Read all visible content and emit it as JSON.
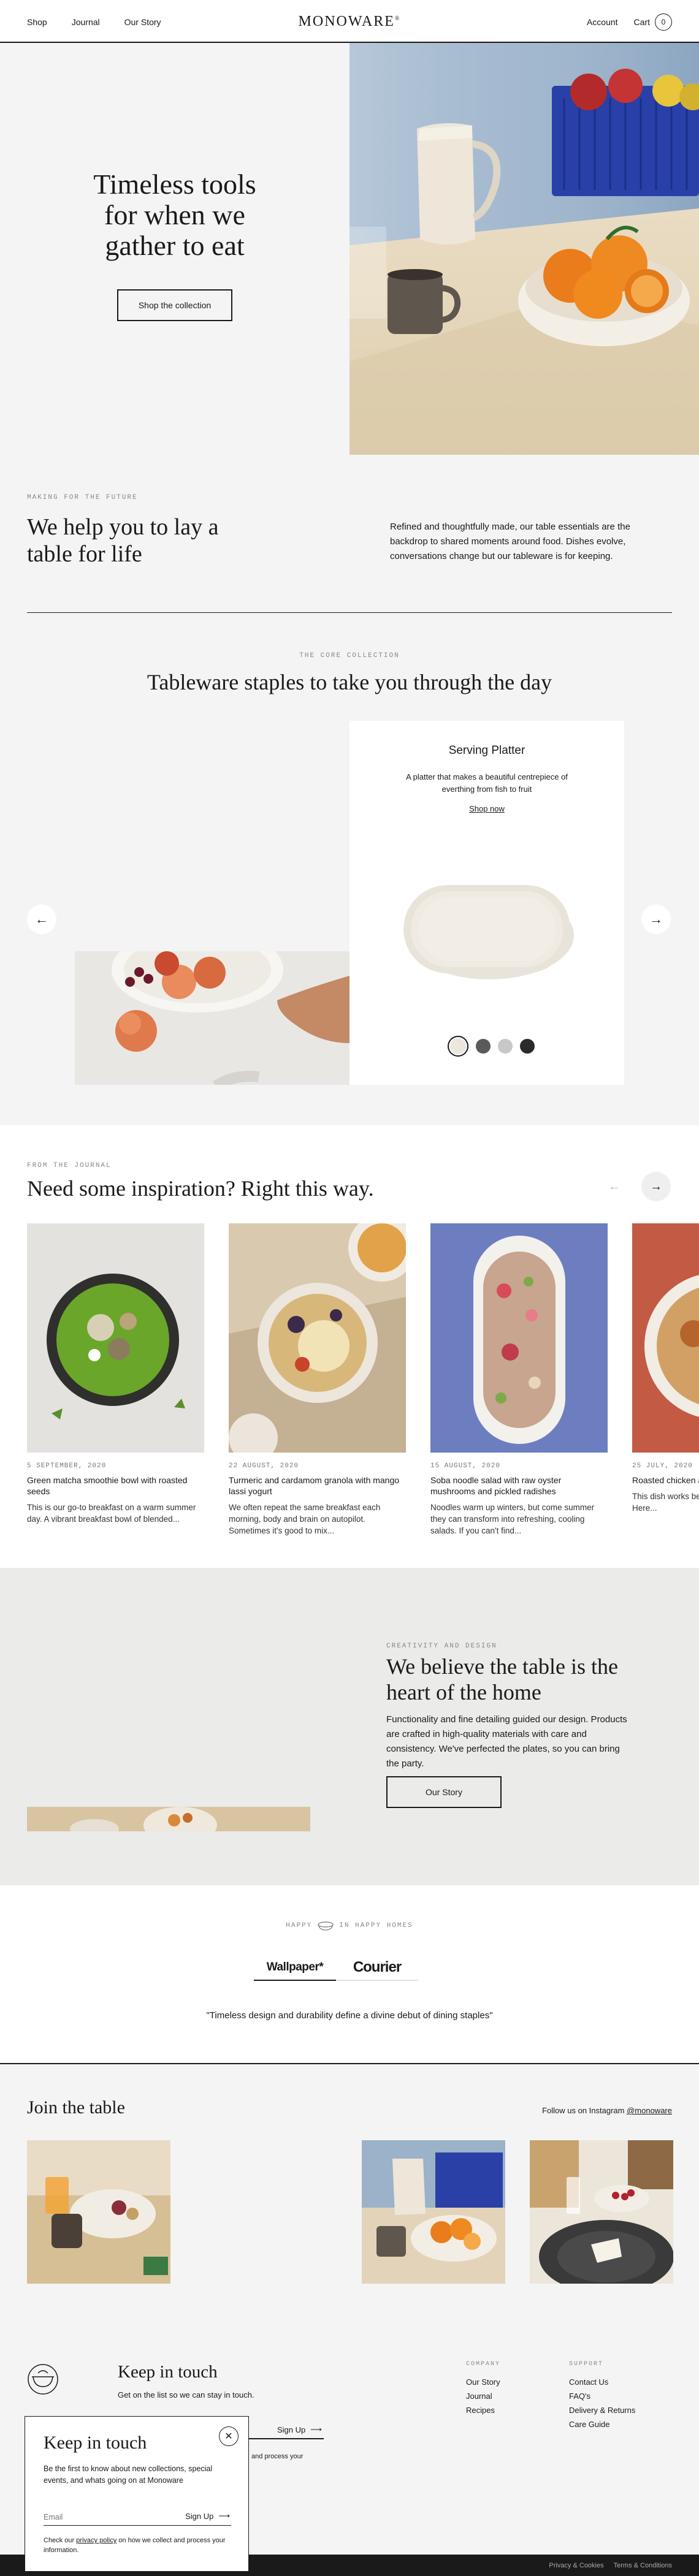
{
  "header": {
    "nav": [
      "Shop",
      "Journal",
      "Our Story"
    ],
    "logo": "MONOWARE",
    "logo_mark": "®",
    "account": "Account",
    "cart_label": "Cart",
    "cart_count": "0"
  },
  "hero": {
    "title_lines": [
      "Timeless tools",
      "for when we",
      "gather to eat"
    ],
    "button": "Shop the collection"
  },
  "intro": {
    "eyebrow": "MAKING FOR THE FUTURE",
    "heading": "We help you to lay a table for life",
    "body": "Refined and thoughtfully made, our table essentials are the backdrop to shared moments around food. Dishes evolve, conversations change but our tableware is for keeping."
  },
  "collection": {
    "eyebrow": "THE CORE COLLECTION",
    "heading": "Tableware staples to take you through the day",
    "product": {
      "title": "Serving Platter",
      "description": "A platter that makes a beautiful centrepiece of everthing from fish to fruit",
      "link": "Shop now",
      "swatches": [
        "#ebe7df",
        "#5a5a5a",
        "#c8c8c8",
        "#2a2a2a"
      ],
      "selected_swatch": 0
    },
    "prev_icon": "arrow-left-icon",
    "next_icon": "arrow-right-icon"
  },
  "journal": {
    "eyebrow": "FROM THE JOURNAL",
    "heading": "Need some inspiration? Right this way.",
    "posts": [
      {
        "date": "5 SEPTEMBER, 2020",
        "title": "Green matcha smoothie bowl with roasted seeds",
        "excerpt": "This is our go-to breakfast on a warm summer day. A vibrant breakfast bowl of blended..."
      },
      {
        "date": "22 AUGUST, 2020",
        "title": "Turmeric and cardamom granola with mango lassi yogurt",
        "excerpt": "We often repeat the same breakfast each morning, body and brain on autopilot. Sometimes it's good to mix..."
      },
      {
        "date": "15 AUGUST, 2020",
        "title": "Soba noodle salad with raw oyster mushrooms and pickled radishes",
        "excerpt": "Noodles warm up winters, but come summer they can transform into refreshing, cooling salads. If you can't find..."
      },
      {
        "date": "25 JULY, 2020",
        "title": "Roasted chicken and smoked cur",
        "excerpt": "This dish works be almost everything roast. Here..."
      }
    ]
  },
  "philosophy": {
    "eyebrow": "CREATIVITY AND DESIGN",
    "heading": "We believe the table is the heart of the home",
    "body": "Functionality and fine detailing guided our design. Products are crafted in high-quality materials with care and consistency. We've perfected the plates, so you can bring the party.",
    "button": "Our Story"
  },
  "press": {
    "eyebrow_left": "HAPPY",
    "eyebrow_right": "IN HAPPY HOMES",
    "logos": [
      "Wallpaper*",
      "Courier"
    ],
    "active_logo": 0,
    "quote": "\"Timeless design and durability define a divine debut of dining staples\""
  },
  "instagram": {
    "heading": "Join the table",
    "follow_text": "Follow us on Instagram",
    "handle": "@monoware"
  },
  "footer": {
    "heading": "Keep in touch",
    "subtitle": "Get on the list so we can stay in touch.",
    "signup": "Sign Up",
    "legal": "and process your",
    "company_title": "COMPANY",
    "company_links": [
      "Our Story",
      "Journal",
      "Recipes"
    ],
    "support_title": "SUPPORT",
    "support_links": [
      "Contact Us",
      "FAQ's",
      "Delivery & Returns",
      "Care Guide"
    ],
    "bottom_links": [
      "Privacy & Cookies",
      "Terms & Conditions"
    ]
  },
  "popup": {
    "heading": "Keep in touch",
    "body": "Be the first to know about new collections, special events, and whats going on at Monoware",
    "email_placeholder": "Email",
    "signup": "Sign Up",
    "legal_prefix": "Check our ",
    "legal_link": "privacy policy",
    "legal_suffix": " on how we collect and process your information."
  }
}
